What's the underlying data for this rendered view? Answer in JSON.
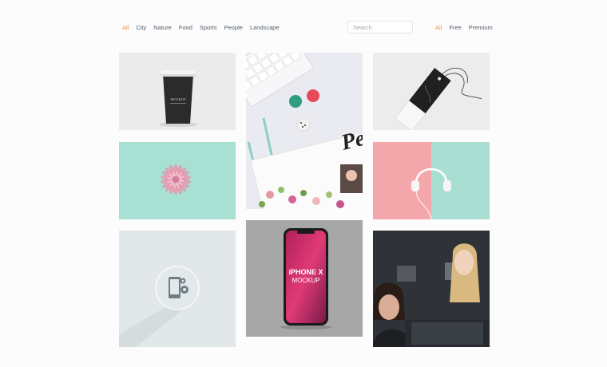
{
  "categories": [
    "All",
    "City",
    "Nature",
    "Food",
    "Sports",
    "People",
    "Landscape"
  ],
  "search": {
    "placeholder": "Search"
  },
  "licenses": [
    "All",
    "Free",
    "Premium"
  ],
  "colors": {
    "accent": "#f0903c",
    "link": "#55606e"
  },
  "gallery": {
    "tiles": [
      {
        "name": "coffee-cup-mockup",
        "label": "MOCKUP"
      },
      {
        "name": "desk-flatlay-magazine",
        "label": "Pep"
      },
      {
        "name": "hang-tag-mockup"
      },
      {
        "name": "pink-flower"
      },
      {
        "name": "headphones-pastel"
      },
      {
        "name": "mobile-settings-icon"
      },
      {
        "name": "iphone-x-mockup",
        "label": "iPHONE X",
        "label2": "MOCKUP"
      },
      {
        "name": "people-office-photo"
      }
    ]
  }
}
